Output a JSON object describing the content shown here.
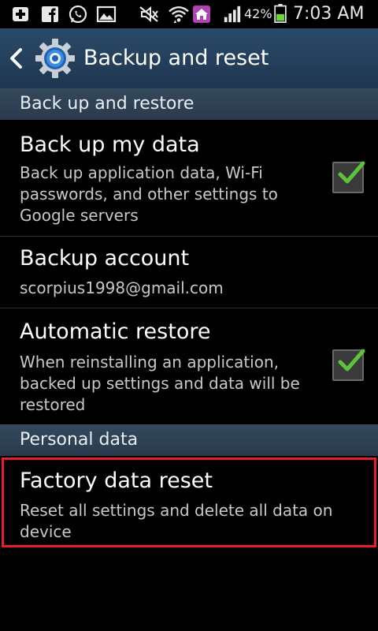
{
  "status_bar": {
    "battery_percent": "42%",
    "time": "7:03 AM"
  },
  "action_bar": {
    "title": "Backup and reset"
  },
  "sections": {
    "backup_restore": {
      "header": "Back up and restore"
    },
    "personal_data": {
      "header": "Personal data"
    }
  },
  "items": {
    "backup_my_data": {
      "title": "Back up my data",
      "summary": "Back up application data, Wi-Fi passwords, and other settings to Google servers",
      "checked": true
    },
    "backup_account": {
      "title": "Backup account",
      "summary": "scorpius1998@gmail.com"
    },
    "automatic_restore": {
      "title": "Automatic restore",
      "summary": "When reinstalling an application, backed up settings and data will be restored",
      "checked": true
    },
    "factory_reset": {
      "title": "Factory data reset",
      "summary": "Reset all settings and delete all data on device"
    }
  },
  "colors": {
    "action_bar": "#1e3650",
    "section_header": "#2c3e50",
    "check_green": "#5cc43a",
    "highlight_red": "#e3202a"
  }
}
